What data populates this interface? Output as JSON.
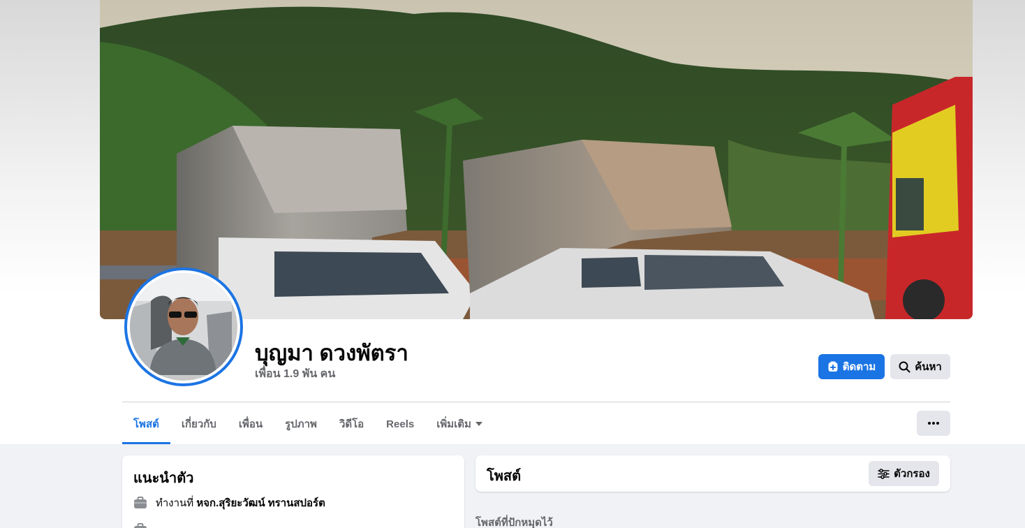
{
  "profile": {
    "name": "บุญมา ดวงพัตรา",
    "friends": "เพื่อน 1.9 พัน คน"
  },
  "actions": {
    "follow_label": "ติดตาม",
    "search_label": "ค้นหา"
  },
  "tabs": [
    {
      "label": "โพสต์",
      "active": true
    },
    {
      "label": "เกี่ยวกับ",
      "active": false
    },
    {
      "label": "เพื่อน",
      "active": false
    },
    {
      "label": "รูปภาพ",
      "active": false
    },
    {
      "label": "วิดีโอ",
      "active": false
    },
    {
      "label": "Reels",
      "active": false
    },
    {
      "label": "เพิ่มเติม",
      "active": false
    }
  ],
  "intro": {
    "title": "แนะนำตัว",
    "work_prefix": "ทำงานที่",
    "work_place": "หจก.สุริยะวัฒน์ ทรานสปอร์ต"
  },
  "posts": {
    "title": "โพสต์",
    "filter_label": "ตัวกรอง",
    "pinned_label": "โพสต์ที่ปักหมุดไว้"
  },
  "colors": {
    "accent": "#1b74e4",
    "secondary_button": "#e4e6eb",
    "background": "#f0f2f5"
  },
  "icons": {
    "follow": "follow-plus-icon",
    "search": "search-icon",
    "more": "more-dots-icon",
    "dropdown": "caret-down-icon",
    "work": "briefcase-icon",
    "filter": "filter-sliders-icon"
  }
}
